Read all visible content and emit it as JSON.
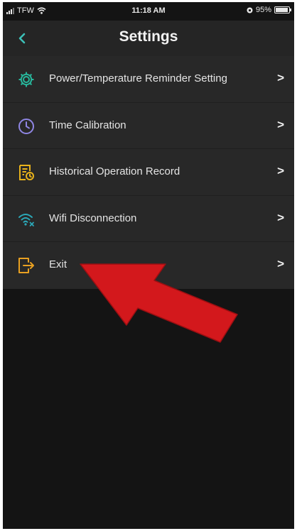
{
  "status_bar": {
    "carrier": "TFW",
    "time": "11:18 AM",
    "battery_percent": "95%",
    "battery_level": 0.95
  },
  "header": {
    "title": "Settings",
    "back_icon": "chevron-left-icon"
  },
  "menu": {
    "items": [
      {
        "label": "Power/Temperature Reminder Setting",
        "icon": "gear-icon",
        "icon_color": "#27b79c"
      },
      {
        "label": "Time Calibration",
        "icon": "clock-icon",
        "icon_color": "#8f86e3"
      },
      {
        "label": "Historical Operation Record",
        "icon": "record-icon",
        "icon_color": "#e8b21b"
      },
      {
        "label": "Wifi Disconnection",
        "icon": "wifi-off-icon",
        "icon_color": "#2ba8b8"
      },
      {
        "label": "Exit",
        "icon": "exit-icon",
        "icon_color": "#e8a021"
      }
    ],
    "chevron": ">"
  },
  "annotation": {
    "arrow_color": "#d3181c",
    "points_to": "Exit"
  },
  "colors": {
    "background": "#141414",
    "nav_bar": "#252525",
    "menu_background": "#282828",
    "accent": "#3cc0b8"
  }
}
